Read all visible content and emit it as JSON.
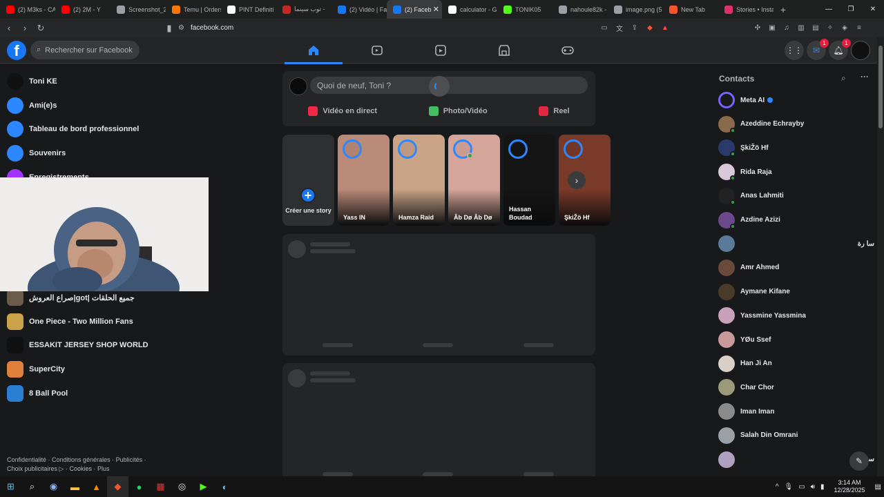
{
  "browser": {
    "tabs": [
      {
        "label": "(2) M3ks - CA",
        "icon": "youtube-icon",
        "color": "#ff0000"
      },
      {
        "label": "(2) 2M - Y",
        "icon": "youtube-icon",
        "color": "#ff0000"
      },
      {
        "label": "Screenshot_2",
        "icon": "globe-icon",
        "color": "#9aa0a6"
      },
      {
        "label": "Temu | Orders",
        "icon": "temu-icon",
        "color": "#fb7701"
      },
      {
        "label": "PINT Definiti",
        "icon": "pint-icon",
        "color": "#ffffff"
      },
      {
        "label": "توب سينما -",
        "icon": "site-icon",
        "color": "#c62828"
      },
      {
        "label": "(2) Vidéo | Fa",
        "icon": "facebook-icon",
        "color": "#1877f2"
      },
      {
        "label": "(2) Faceb",
        "icon": "facebook-icon",
        "color": "#1877f2",
        "active": true
      },
      {
        "label": "calculator - G",
        "icon": "google-icon",
        "color": "#ffffff"
      },
      {
        "label": "TONIK05",
        "icon": "kick-icon",
        "color": "#53fc18"
      },
      {
        "label": "nahoule82k -",
        "icon": "globe-icon",
        "color": "#9aa0a6"
      },
      {
        "label": "image.png (5",
        "icon": "globe-icon",
        "color": "#9aa0a6"
      },
      {
        "label": "New Tab",
        "icon": "brave-icon",
        "color": "#fb542b"
      },
      {
        "label": "Stories • Insta",
        "icon": "instagram-icon",
        "color": "#e1306c"
      }
    ],
    "url": "facebook.com"
  },
  "fb": {
    "search_placeholder": "Rechercher sur Facebook",
    "messenger_badge": "1",
    "notif_badge": "1"
  },
  "left": {
    "items": [
      {
        "label": "Toni KE",
        "icon": "user-avatar-icon",
        "color": "#111111"
      },
      {
        "label": "Ami(e)s",
        "icon": "friends-icon",
        "color": "#2d88ff"
      },
      {
        "label": "Tableau de bord professionnel",
        "icon": "dashboard-icon",
        "color": "#2d88ff"
      },
      {
        "label": "Souvenirs",
        "icon": "clock-icon",
        "color": "#2d88ff"
      },
      {
        "label": "Enregistrements",
        "icon": "bookmark-icon",
        "color": "#a033ff"
      }
    ],
    "shortcuts": [
      {
        "label": "صراع العروش|got| جميع الحلقات",
        "color": "#6b5b4a"
      },
      {
        "label": "One Piece - Two Million Fans",
        "color": "#c9a24a"
      },
      {
        "label": "ESSAKIT JERSEY SHOP WORLD",
        "color": "#111111"
      },
      {
        "label": "SuperCity",
        "color": "#e0803a"
      },
      {
        "label": "8 Ball Pool",
        "color": "#2a7fd4"
      }
    ],
    "footer": "Confidentialité · Conditions générales · Publicités · Choix publicitaires ▷ · Cookies · Plus"
  },
  "composer": {
    "placeholder": "Quoi de neuf, Toni ?",
    "actions": [
      {
        "label": "Vidéo en direct",
        "color": "#f02849"
      },
      {
        "label": "Photo/Vidéo",
        "color": "#45bd62"
      },
      {
        "label": "Reel",
        "color": "#e42645"
      }
    ]
  },
  "stories": {
    "create_label": "Créer une story",
    "items": [
      {
        "name": "Yass IN",
        "color": "#b98a78"
      },
      {
        "name": "Hamza Raid",
        "color": "#c8a386"
      },
      {
        "name": "Âb Dø Âb Dø",
        "color": "#d5a59a",
        "online": true
      },
      {
        "name": "Hassan Boudad",
        "color": "#151515"
      },
      {
        "name": "ŞkiŽö Hf",
        "color": "#7a3a2a"
      }
    ]
  },
  "contacts": {
    "title": "Contacts",
    "items": [
      {
        "name": "Meta AI",
        "color": "#7b61ff",
        "verified": true
      },
      {
        "name": "Azeddine Echrayby",
        "color": "#8a6a4a",
        "online": true
      },
      {
        "name": "ŞkiŽö Hf",
        "color": "#2a3a6a",
        "online": true
      },
      {
        "name": "Rida Raja",
        "color": "#d9c8d8",
        "online": true
      },
      {
        "name": "Anas Lahmiti",
        "color": "#222222",
        "online": true
      },
      {
        "name": "Azdine Azizi",
        "color": "#6a4a8a",
        "online": true
      },
      {
        "name": "سا رة",
        "color": "#5a7a9a",
        "rtl": true
      },
      {
        "name": "Amr Ahmed",
        "color": "#6a4a3a"
      },
      {
        "name": "Aymane Kifane",
        "color": "#4a3a2a"
      },
      {
        "name": "Yassmine Yassmina",
        "color": "#c8a0b8"
      },
      {
        "name": "YØu Ssef",
        "color": "#c89a9a"
      },
      {
        "name": "Han Ji An",
        "color": "#d8d0c8"
      },
      {
        "name": "Char Chor",
        "color": "#9a9a7a"
      },
      {
        "name": "Iman Iman",
        "color": "#8a8a8a"
      },
      {
        "name": "Salah Din Omrani",
        "color": "#9aa0a6"
      },
      {
        "name": "سين",
        "color": "#b0a0c0",
        "rtl": true
      }
    ]
  },
  "taskbar": {
    "time": "3:14 AM",
    "date": "12/28/2025"
  }
}
